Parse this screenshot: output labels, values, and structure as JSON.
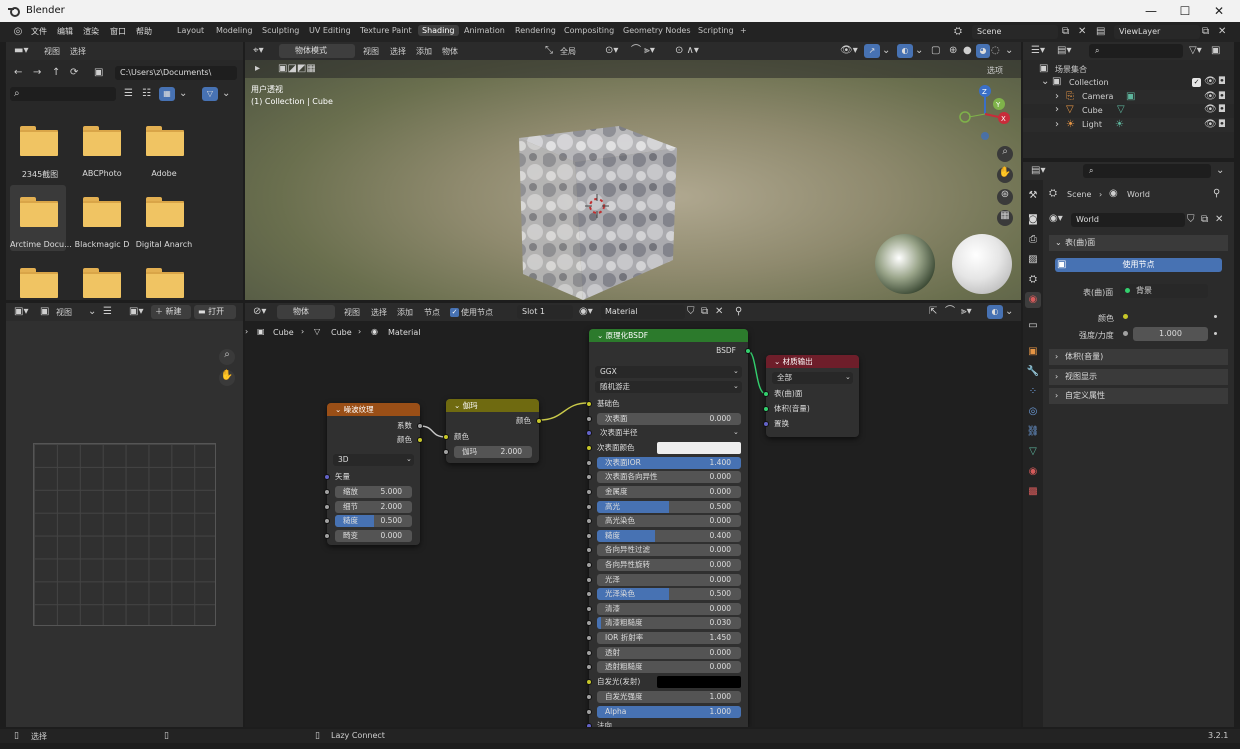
{
  "window": {
    "title": "Blender",
    "minimize": "—",
    "maximize": "☐",
    "close": "✕"
  },
  "menu": {
    "file": "文件",
    "edit": "编辑",
    "render": "渲染",
    "window": "窗口",
    "help": "帮助"
  },
  "workspaces": [
    "Layout",
    "Modeling",
    "Sculpting",
    "UV Editing",
    "Texture Paint",
    "Shading",
    "Animation",
    "Rendering",
    "Compositing",
    "Geometry Nodes",
    "Scripting",
    "+"
  ],
  "scene_selector": {
    "scene": "Scene",
    "view_layer": "ViewLayer"
  },
  "file_browser": {
    "menu_view": "视图",
    "menu_select": "选择",
    "path": "C:\\Users\\z\\Documents\\",
    "folders": [
      "2345截图",
      "ABCPhoto",
      "Adobe",
      "Arctime Docu...",
      "Blackmagic D",
      "Digital Anarch",
      "",
      ""
    ]
  },
  "viewport": {
    "mode": "物体模式",
    "menu_view": "视图",
    "menu_select": "选择",
    "menu_add": "添加",
    "menu_object": "物体",
    "transform": "全局",
    "options": "选项",
    "overlay_line1": "用户透视",
    "overlay_line2": "(1) Collection | Cube",
    "gizmo_z": "Z",
    "gizmo_y": "Y",
    "gizmo_x": "X"
  },
  "image_editor": {
    "menu_view": "视图",
    "new": "新建",
    "open": "打开"
  },
  "node_editor": {
    "type": "物体",
    "menu_view": "视图",
    "menu_select": "选择",
    "menu_add": "添加",
    "menu_node": "节点",
    "use_nodes": "使用节点",
    "slot": "Slot 1",
    "material": "Material",
    "breadcrumb": [
      "Cube",
      "Cube",
      "Material"
    ]
  },
  "nodes": {
    "noise": {
      "title": "噪波纹理",
      "out_fac": "系数",
      "out_color": "颜色",
      "dim": "3D",
      "in_vector": "矢量",
      "fields": [
        {
          "label": "缩放",
          "value": "5.000",
          "fill": 0
        },
        {
          "label": "细节",
          "value": "2.000",
          "fill": 0
        },
        {
          "label": "糙度",
          "value": "0.500",
          "fill": 0.5
        },
        {
          "label": "畸变",
          "value": "0.000",
          "fill": 0
        }
      ]
    },
    "gamma": {
      "title": "伽玛",
      "out_color": "颜色",
      "in_color": "颜色",
      "field_label": "伽玛",
      "field_value": "2.000"
    },
    "bsdf": {
      "title": "原理化BSDF",
      "out": "BSDF",
      "distribution": "GGX",
      "subsurface_method": "随机游走",
      "base_color": "基础色",
      "subsurface_radius": "次表面半径",
      "subsurface_color": "次表面颜色",
      "fields": [
        {
          "label": "次表面",
          "value": "0.000",
          "fill": 0
        },
        {
          "label": "次表面IOR",
          "value": "1.400",
          "fill": 1
        },
        {
          "label": "次表面各向异性",
          "value": "0.000",
          "fill": 0
        },
        {
          "label": "金属度",
          "value": "0.000",
          "fill": 0
        },
        {
          "label": "高光",
          "value": "0.500",
          "fill": 0.5
        },
        {
          "label": "高光染色",
          "value": "0.000",
          "fill": 0
        },
        {
          "label": "糙度",
          "value": "0.400",
          "fill": 0.4
        },
        {
          "label": "各向异性过滤",
          "value": "0.000",
          "fill": 0
        },
        {
          "label": "各向异性旋转",
          "value": "0.000",
          "fill": 0
        },
        {
          "label": "光泽",
          "value": "0.000",
          "fill": 0
        },
        {
          "label": "光泽染色",
          "value": "0.500",
          "fill": 0.5
        },
        {
          "label": "清漆",
          "value": "0.000",
          "fill": 0
        },
        {
          "label": "清漆粗糙度",
          "value": "0.030",
          "fill": 0.03
        },
        {
          "label": "IOR 折射率",
          "value": "1.450",
          "fill": 0
        },
        {
          "label": "透射",
          "value": "0.000",
          "fill": 0
        },
        {
          "label": "透射粗糙度",
          "value": "0.000",
          "fill": 0
        }
      ],
      "emission": "自发光(发射)",
      "emission_strength_label": "自发光强度",
      "emission_strength": "1.000",
      "alpha_label": "Alpha",
      "alpha_value": "1.000",
      "normal": "法向"
    },
    "output": {
      "title": "材质输出",
      "target": "全部",
      "in_surface": "表(曲)面",
      "in_volume": "体积(音量)",
      "in_displacement": "置换"
    }
  },
  "outliner": {
    "root": "场景集合",
    "collection": "Collection",
    "items": [
      "Camera",
      "Cube",
      "Light"
    ]
  },
  "properties": {
    "breadcrumb_scene": "Scene",
    "breadcrumb_world": "World",
    "world_name": "World",
    "surface_panel": "表(曲)面",
    "use_nodes_btn": "使用节点",
    "surface_label": "表(曲)面",
    "surface_value": "背景",
    "color_label": "颜色",
    "strength_label": "强度/力度",
    "strength_value": "1.000",
    "panels": [
      "体积(音量)",
      "视图显示",
      "自定义属性"
    ]
  },
  "statusbar": {
    "select": "选择",
    "lazy": "Lazy Connect",
    "version": "3.2.1"
  },
  "colors": {
    "accent": "#4772b3",
    "noise_header": "#9a4f17",
    "gamma_header": "#6f6a10",
    "bsdf_header": "#2c7a2c",
    "output_header": "#6e1e2a"
  }
}
